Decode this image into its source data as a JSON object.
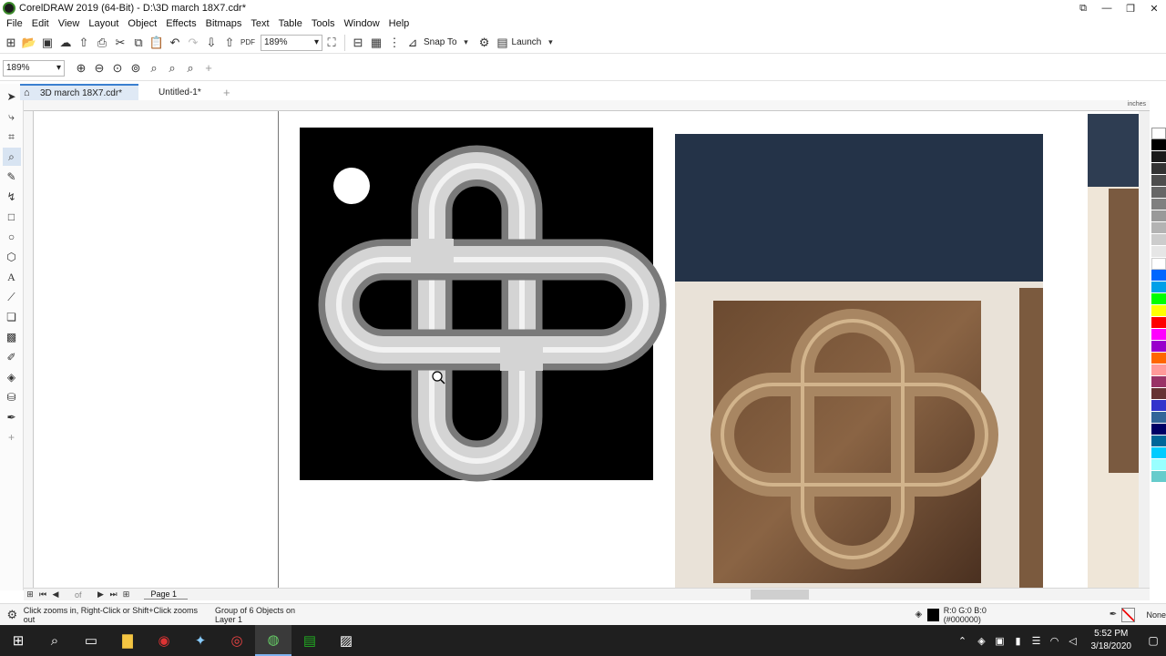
{
  "window": {
    "title": "CorelDRAW 2019 (64-Bit) - D:\\3D march 18X7.cdr*"
  },
  "menu": [
    "File",
    "Edit",
    "View",
    "Layout",
    "Object",
    "Effects",
    "Bitmaps",
    "Text",
    "Table",
    "Tools",
    "Window",
    "Help"
  ],
  "toolbar": {
    "zoom": "189%",
    "snap_to": "Snap To",
    "launch": "Launch"
  },
  "propbar": {
    "zoom": "189%"
  },
  "tabs": [
    {
      "label": "3D march 18X7.cdr*"
    },
    {
      "label": "Untitled-1*"
    }
  ],
  "ruler": {
    "unit": "inches"
  },
  "pagenav": {
    "of_label": "of",
    "page_tab": "Page 1"
  },
  "status": {
    "hint": "Click zooms in, Right-Click or Shift+Click zooms out",
    "selection": "Group of 6 Objects on Layer 1",
    "fill": "R:0 G:0 B:0 (#000000)",
    "outline": "None"
  },
  "taskbar": {
    "time": "5:52 PM",
    "date": "3/18/2020"
  },
  "palette_colors": [
    "#ffffff",
    "#000000",
    "#1a1a1a",
    "#333333",
    "#4d4d4d",
    "#666666",
    "#808080",
    "#999999",
    "#b3b3b3",
    "#cccccc",
    "#e6e6e6",
    "#ffffff",
    "#0066ff",
    "#00a0e8",
    "#00ff00",
    "#ffff00",
    "#ff0000",
    "#ff00ff",
    "#9900cc",
    "#ff6600",
    "#ff9999",
    "#993366",
    "#663333",
    "#3333cc",
    "#336699",
    "#000066",
    "#006699",
    "#00ccff",
    "#99ffff",
    "#66cccc"
  ]
}
